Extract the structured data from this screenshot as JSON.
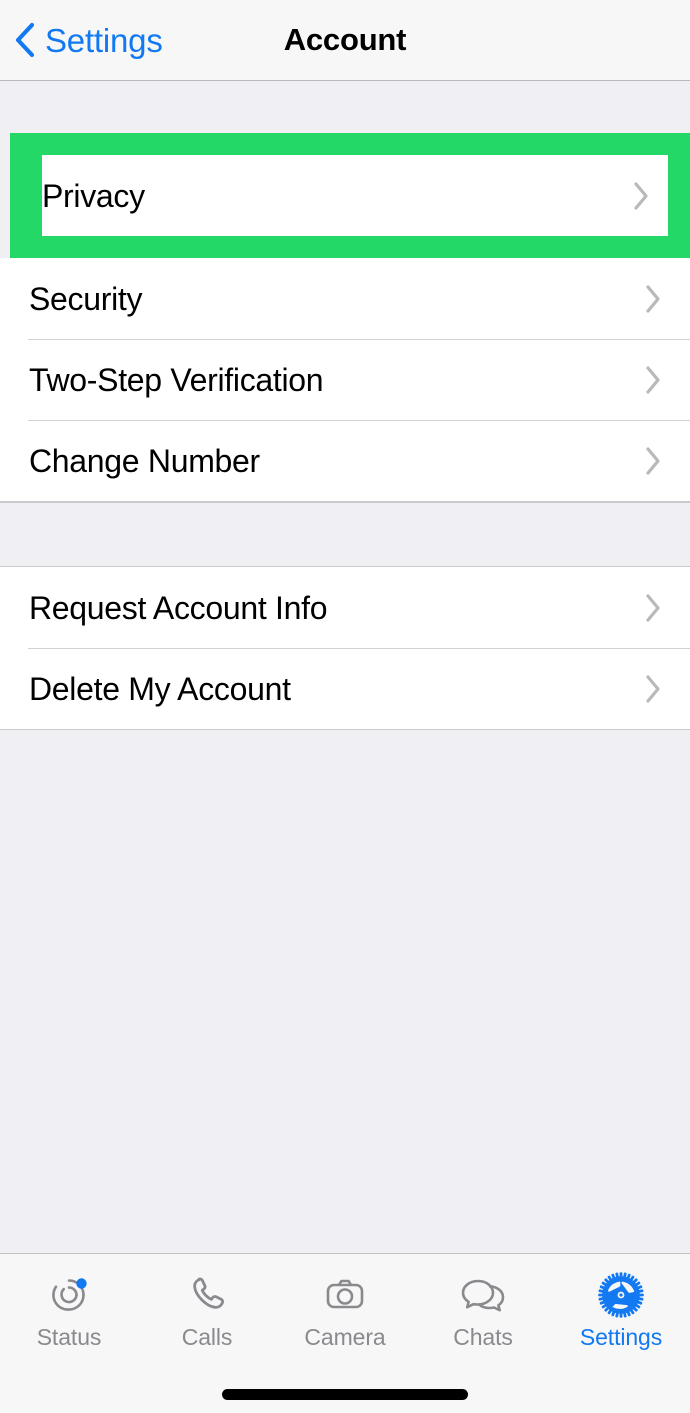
{
  "navbar": {
    "back_label": "Settings",
    "back_icon": "chevron-left-icon",
    "title": "Account"
  },
  "colors": {
    "accent_blue": "#1279F2",
    "highlight_green": "#23D866",
    "background_gray": "#EFEFF4",
    "row_white": "#FFFFFF",
    "chevron_gray": "#B8B8BD",
    "label_gray": "#8A8A8E"
  },
  "groups": [
    {
      "name": "account-primary-group",
      "rows": [
        {
          "label": "Privacy",
          "chevron": "chevron-right-icon",
          "highlighted": true
        },
        {
          "label": "Security",
          "chevron": "chevron-right-icon",
          "highlighted": false
        },
        {
          "label": "Two-Step Verification",
          "chevron": "chevron-right-icon",
          "highlighted": false
        },
        {
          "label": "Change Number",
          "chevron": "chevron-right-icon",
          "highlighted": false
        }
      ]
    },
    {
      "name": "account-data-group",
      "rows": [
        {
          "label": "Request Account Info",
          "chevron": "chevron-right-icon",
          "highlighted": false
        },
        {
          "label": "Delete My Account",
          "chevron": "chevron-right-icon",
          "highlighted": false
        }
      ]
    }
  ],
  "tabbar": {
    "items": [
      {
        "label": "Status",
        "icon": "status-rings-icon",
        "active": false,
        "badge": true
      },
      {
        "label": "Calls",
        "icon": "phone-icon",
        "active": false,
        "badge": false
      },
      {
        "label": "Camera",
        "icon": "camera-icon",
        "active": false,
        "badge": false
      },
      {
        "label": "Chats",
        "icon": "chat-bubbles-icon",
        "active": false,
        "badge": false
      },
      {
        "label": "Settings",
        "icon": "gear-icon",
        "active": true,
        "badge": false
      }
    ]
  }
}
